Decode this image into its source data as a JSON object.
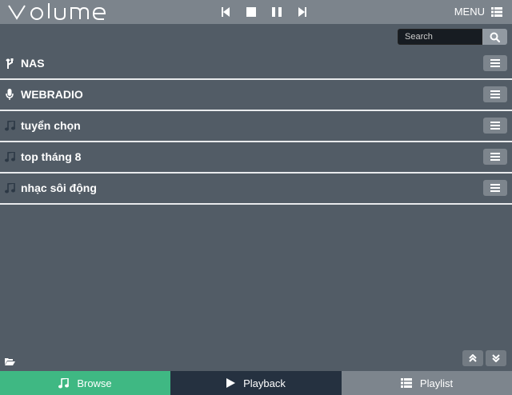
{
  "header": {
    "logo": "VOLUME",
    "menu_label": "MENU"
  },
  "search": {
    "placeholder": "Search"
  },
  "library": {
    "items": [
      {
        "label": "NAS",
        "icon": "usb-icon"
      },
      {
        "label": "WEBRADIO",
        "icon": "microphone-icon"
      },
      {
        "label": "tuyển chọn",
        "icon": "music-note-icon"
      },
      {
        "label": "top tháng 8",
        "icon": "music-note-icon"
      },
      {
        "label": "nhạc sôi động",
        "icon": "music-note-icon"
      }
    ]
  },
  "tabs": {
    "browse": "Browse",
    "playback": "Playback",
    "playlist": "Playlist"
  },
  "colors": {
    "background": "#525c66",
    "topbar": "#7c848c",
    "browse_tab": "#3fb883",
    "playback_tab": "#253140",
    "playlist_tab": "#7d858d"
  }
}
